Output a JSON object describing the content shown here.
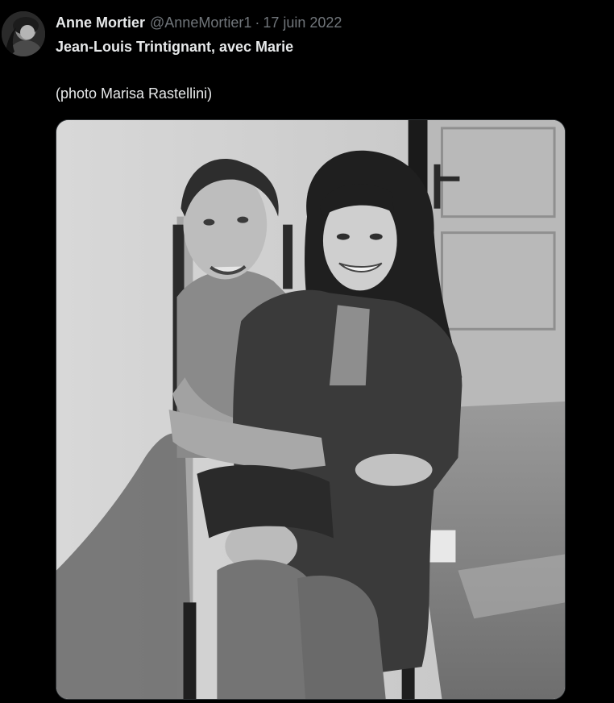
{
  "tweet": {
    "display_name": "Anne Mortier",
    "handle": "@AnneMortier1",
    "separator": "·",
    "date": "17 juin 2022",
    "text_line1": "Jean-Louis Trintignant, avec Marie",
    "text_line2": "(photo Marisa Rastellini)"
  },
  "colors": {
    "background": "#000000",
    "primary_text": "#e7e9ea",
    "secondary_text": "#71767b"
  },
  "media": {
    "type": "photo",
    "style": "black-and-white",
    "icon": "photo-icon"
  }
}
